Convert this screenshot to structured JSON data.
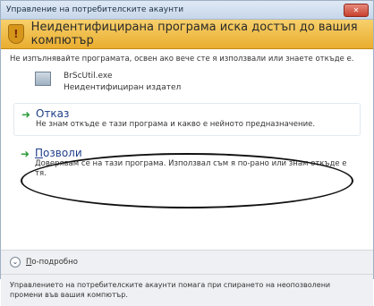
{
  "window": {
    "title": "Управление на потребителските акаунти",
    "close_label": "✕"
  },
  "banner": {
    "title": "Неидентифицирана програма иска достъп до вашия компютър",
    "icon": "shield-warning-icon"
  },
  "warning_text": "Не изпълнявайте програмата, освен ако вече сте я използвали или знаете откъде е.",
  "program": {
    "name": "BrScUtil.exe",
    "publisher": "Неидентифициран издател"
  },
  "options": {
    "deny": {
      "title": "Отказ",
      "description": "Не знам откъде е тази програма и какво е нейното предназначение."
    },
    "allow": {
      "title_first_letter": "П",
      "title_rest": "озволи",
      "description": "Доверявам се на тази програма. Използвал съм я по-рано или знам откъде е тя."
    }
  },
  "more_details": {
    "first_letter": "П",
    "rest": "о-подробно"
  },
  "footer_note": "Управлението на потребителските акаунти помага при спирането на неопозволени промени във вашия компютър.",
  "colors": {
    "banner": "#e9ad2f",
    "link": "#1f3f8a",
    "arrow": "#2e9d3b"
  }
}
